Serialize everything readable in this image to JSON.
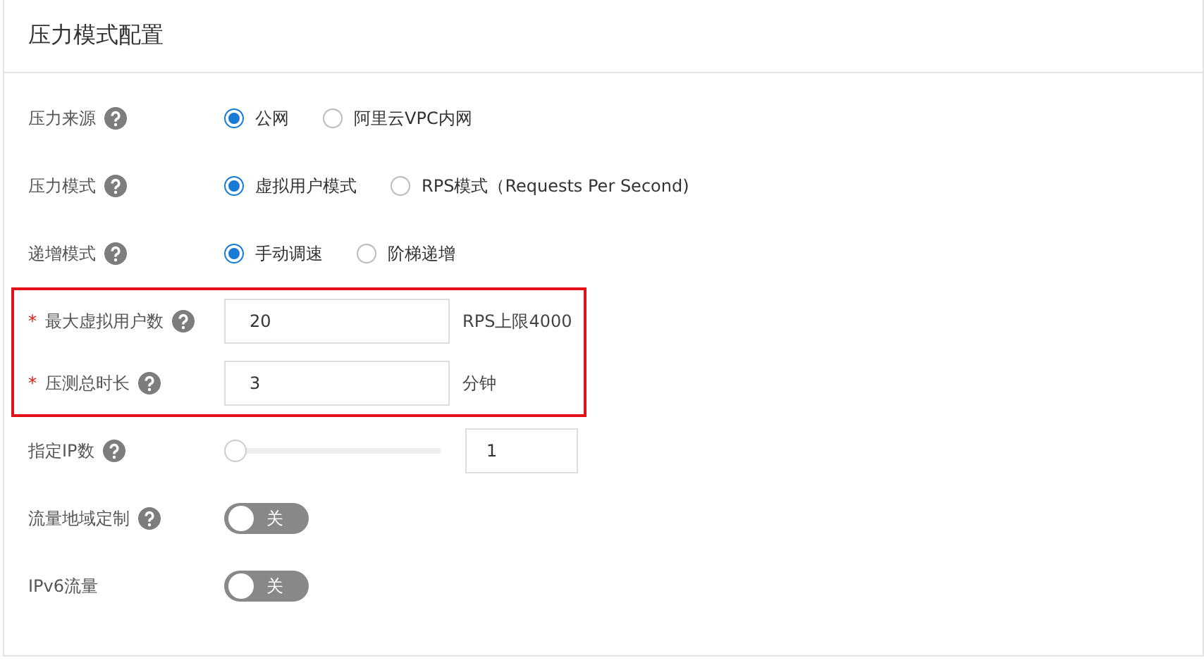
{
  "panel": {
    "title": "压力模式配置"
  },
  "rows": [
    {
      "kind": "radio",
      "label": "压力来源",
      "help": true,
      "highlighted": false,
      "options": [
        {
          "label": "公网",
          "selected": true
        },
        {
          "label": "阿里云VPC内网",
          "selected": false
        }
      ]
    },
    {
      "kind": "radio",
      "label": "压力模式",
      "help": true,
      "highlighted": false,
      "options": [
        {
          "label": "虚拟用户模式",
          "selected": true
        },
        {
          "label": "RPS模式（Requests Per Second)",
          "selected": false
        }
      ]
    },
    {
      "kind": "radio",
      "label": "递增模式",
      "help": true,
      "highlighted": false,
      "options": [
        {
          "label": "手动调速",
          "selected": true
        },
        {
          "label": "阶梯递增",
          "selected": false
        }
      ]
    },
    {
      "kind": "input",
      "label": "最大虚拟用户数",
      "required_mark": "*",
      "help": true,
      "highlighted": true,
      "value": "20",
      "suffix": "RPS上限4000"
    },
    {
      "kind": "input",
      "label": "压测总时长",
      "required_mark": "*",
      "help": true,
      "highlighted": true,
      "value": "3",
      "suffix": "分钟"
    },
    {
      "kind": "slider",
      "label": "指定IP数",
      "help": true,
      "highlighted": false,
      "level": 0,
      "value": "1"
    },
    {
      "kind": "switch",
      "label": "流量地域定制",
      "help": true,
      "highlighted": false,
      "on": false,
      "state_label": "关"
    },
    {
      "kind": "switch",
      "label": "IPv6流量",
      "help": false,
      "highlighted": false,
      "on": false,
      "state_label": "关"
    }
  ]
}
